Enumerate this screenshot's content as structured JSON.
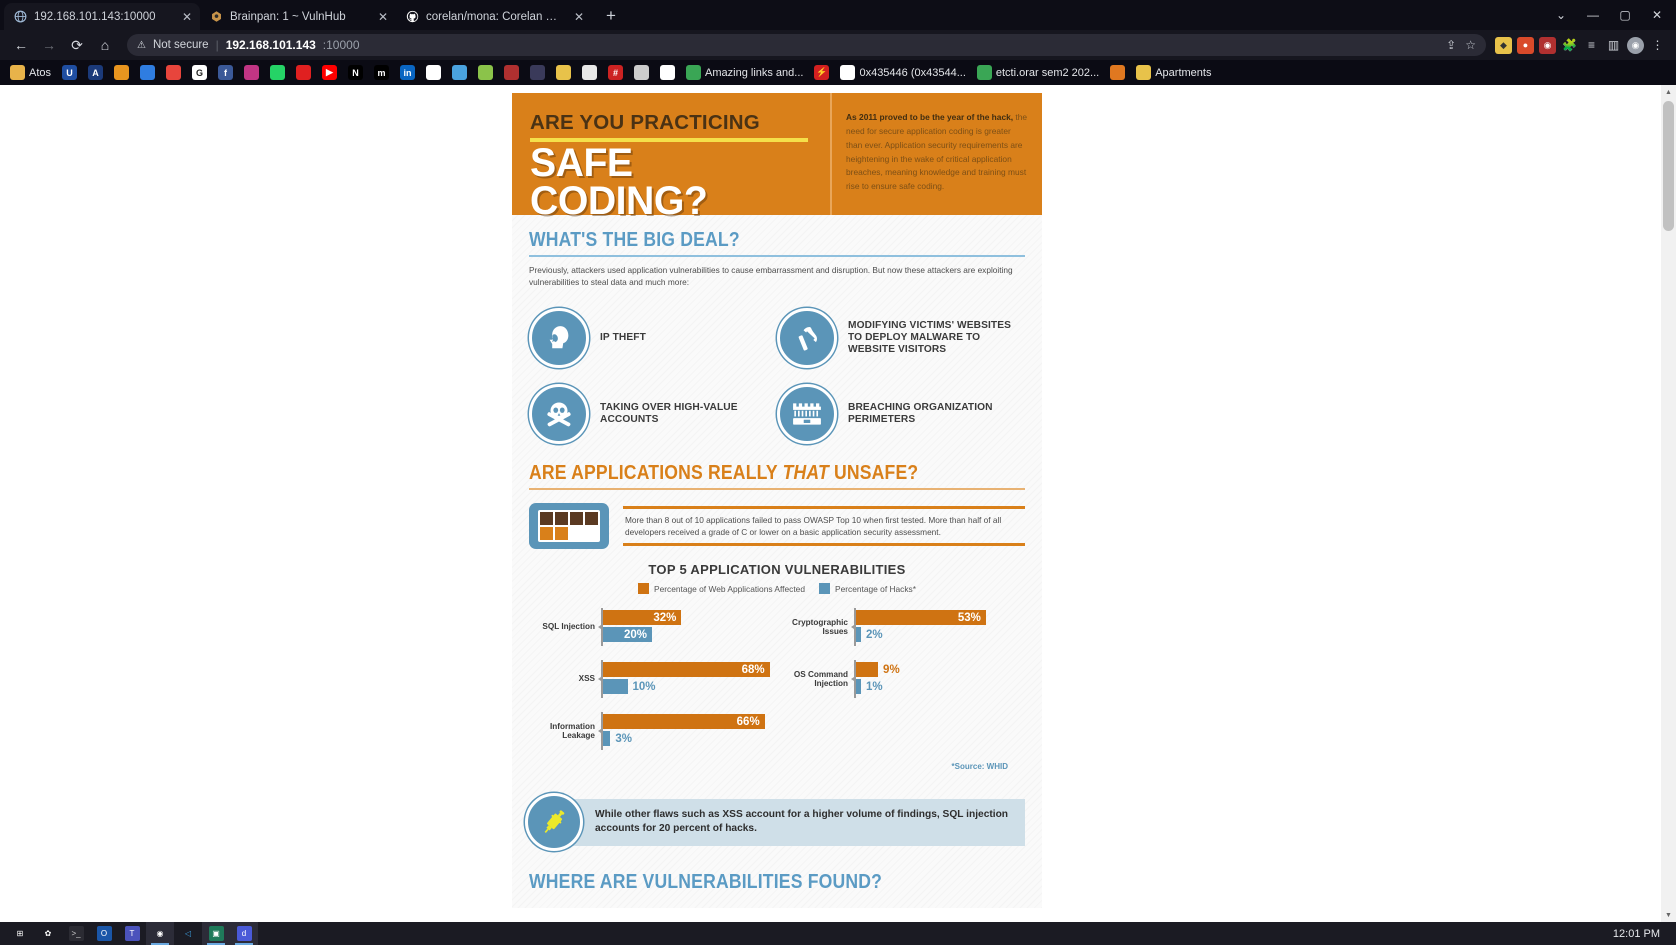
{
  "browser": {
    "tabs": [
      {
        "title": "192.168.101.143:10000",
        "favicon": "globe-icon",
        "active": true
      },
      {
        "title": "Brainpan: 1 ~ VulnHub",
        "favicon": "vulnhub-icon",
        "active": false
      },
      {
        "title": "corelan/mona: Corelan Repositor",
        "favicon": "github-icon",
        "active": false
      }
    ],
    "new_tab_label": "+",
    "window_controls": [
      "⌄",
      "—",
      "▢",
      "✕"
    ],
    "toolbar": {
      "back": "←",
      "forward": "→",
      "reload": "⟳",
      "home": "⌂",
      "security_label": "Not secure",
      "url_host": "192.168.101.143",
      "url_port": ":10000",
      "share_icon": "share-icon",
      "bookmark_icon": "star-icon",
      "menu_icon": "kebab-menu-icon",
      "profile_icon": "profile-avatar-icon",
      "sidepanel_icon": "side-panel-icon",
      "extensions_icon": "puzzle-piece-icon",
      "reading_list_icon": "reading-list-icon"
    },
    "bookmarks": [
      {
        "label": "Atos",
        "color": "#e8b34a",
        "glyph": "",
        "has_label": true
      },
      {
        "label": "",
        "color": "#1f4ea1",
        "glyph": "U",
        "has_label": false
      },
      {
        "label": "",
        "color": "#1b3a7a",
        "glyph": "A",
        "has_label": false
      },
      {
        "label": "",
        "color": "#e8951f",
        "glyph": "",
        "has_label": false
      },
      {
        "label": "",
        "color": "#2f7de1",
        "glyph": "",
        "has_label": false
      },
      {
        "label": "",
        "color": "#e8453c",
        "glyph": "",
        "has_label": false
      },
      {
        "label": "",
        "color": "#ffffff",
        "glyph": "G",
        "has_label": false
      },
      {
        "label": "",
        "color": "#3b5998",
        "glyph": "f",
        "has_label": false
      },
      {
        "label": "",
        "color": "#c13584",
        "glyph": "",
        "has_label": false
      },
      {
        "label": "",
        "color": "#25d366",
        "glyph": "",
        "has_label": false
      },
      {
        "label": "",
        "color": "#e02020",
        "glyph": "",
        "has_label": false
      },
      {
        "label": "",
        "color": "#ff0000",
        "glyph": "▶",
        "has_label": false
      },
      {
        "label": "",
        "color": "#000000",
        "glyph": "N",
        "has_label": false
      },
      {
        "label": "",
        "color": "#000000",
        "glyph": "m",
        "has_label": false
      },
      {
        "label": "",
        "color": "#0a66c2",
        "glyph": "in",
        "has_label": false
      },
      {
        "label": "",
        "color": "#ffffff",
        "glyph": "",
        "has_label": false
      },
      {
        "label": "",
        "color": "#4aa3df",
        "glyph": "",
        "has_label": false
      },
      {
        "label": "",
        "color": "#8bc34a",
        "glyph": "",
        "has_label": false
      },
      {
        "label": "",
        "color": "#b03030",
        "glyph": "",
        "has_label": false
      },
      {
        "label": "",
        "color": "#3a3a5a",
        "glyph": "",
        "has_label": false
      },
      {
        "label": "",
        "color": "#e8c24a",
        "glyph": "",
        "has_label": false
      },
      {
        "label": "",
        "color": "#e8e8e8",
        "glyph": "",
        "has_label": false
      },
      {
        "label": "",
        "color": "#cc2222",
        "glyph": "#",
        "has_label": false
      },
      {
        "label": "",
        "color": "#cccccc",
        "glyph": "",
        "has_label": false
      },
      {
        "label": "",
        "color": "#ffffff",
        "glyph": "",
        "has_label": false
      },
      {
        "label": "Amazing links and...",
        "color": "#3aa655",
        "glyph": "",
        "has_label": true
      },
      {
        "label": "",
        "color": "#d32020",
        "glyph": "⚡",
        "has_label": false
      },
      {
        "label": "0x435446 (0x43544...",
        "color": "#ffffff",
        "glyph": "",
        "has_label": true
      },
      {
        "label": "etcti.orar sem2 202...",
        "color": "#3aa655",
        "glyph": "",
        "has_label": true
      },
      {
        "label": "",
        "color": "#e07820",
        "glyph": "",
        "has_label": false
      },
      {
        "label": "Apartments",
        "color": "#e8c24a",
        "glyph": "",
        "has_label": true
      }
    ]
  },
  "infographic": {
    "header": {
      "line1": "ARE YOU PRACTICING",
      "line2": "SAFE CODING?",
      "intro_bold": "As 2011 proved to be the year of the hack,",
      "intro_rest": " the need for secure application coding is greater than ever. Application security requirements are heightening in the wake of critical application breaches, meaning knowledge and training must rise to ensure safe coding."
    },
    "section1": {
      "heading": "WHAT'S THE BIG DEAL?",
      "paragraph": "Previously, attackers used application vulnerabilities to cause embarrassment and disruption. But now these attackers are exploiting vulnerabilities to steal data and much more:",
      "items": [
        {
          "label": "IP THEFT",
          "icon": "head-hand-icon"
        },
        {
          "label": "MODIFYING VICTIMS' WEBSITES TO DEPLOY MALWARE TO WEBSITE VISITORS",
          "icon": "hammer-icon"
        },
        {
          "label": "TAKING OVER HIGH-VALUE ACCOUNTS",
          "icon": "skull-crossbones-icon"
        },
        {
          "label": "BREACHING ORGANIZATION PERIMETERS",
          "icon": "fortress-wall-icon"
        }
      ]
    },
    "section2": {
      "heading_pre": "ARE APPLICATIONS REALLY ",
      "heading_em": "THAT",
      "heading_post": " UNSAFE?",
      "stat_text": "More than 8 out of 10 applications failed to pass OWASP Top 10 when first tested. More than half of all developers received a grade of C or lower on a basic application security assessment.",
      "source_note": "*Source: WHID",
      "callout": "While other flaws such as XSS account for a higher volume of findings, SQL injection accounts for 20 percent of hacks.",
      "callout_icon": "syringe-icon"
    },
    "section3": {
      "heading": "WHERE ARE VULNERABILITIES FOUND?"
    },
    "colors": {
      "orange": "#d9801a",
      "bar_orange": "#cf7312",
      "blue": "#5b95b8",
      "heading_blue": "#5b9bc4",
      "yellow": "#f5e04a",
      "callout_bg": "#cfdfe8"
    }
  },
  "chart_data": {
    "type": "bar",
    "title": "TOP 5 APPLICATION VULNERABILITIES",
    "orientation": "horizontal",
    "xlabel": "",
    "ylabel": "",
    "xlim": [
      0,
      100
    ],
    "grid": false,
    "legend_position": "top-center",
    "legend": [
      {
        "name": "Percentage of Web Applications Affected",
        "color": "#cf7312"
      },
      {
        "name": "Percentage of Hacks*",
        "color": "#5b95b8"
      }
    ],
    "categories": [
      "SQL Injection",
      "XSS",
      "Information Leakage",
      "Cryptographic Issues",
      "OS Command Injection"
    ],
    "series": [
      {
        "name": "Percentage of Web Applications Affected",
        "color": "#cf7312",
        "values": [
          32,
          68,
          66,
          53,
          9
        ],
        "labels": [
          "32%",
          "68%",
          "66%",
          "53%",
          "9%"
        ]
      },
      {
        "name": "Percentage of Hacks*",
        "color": "#5b95b8",
        "values": [
          20,
          10,
          3,
          2,
          1
        ],
        "labels": [
          "20%",
          "10%",
          "3%",
          "2%",
          "1%"
        ]
      }
    ],
    "left_column": [
      {
        "category": "SQL Injection",
        "orange": 32,
        "orange_label": "32%",
        "blue": 20,
        "blue_label": "20%"
      },
      {
        "category": "XSS",
        "orange": 68,
        "orange_label": "68%",
        "blue": 10,
        "blue_label": "10%"
      },
      {
        "category": "Information Leakage",
        "orange": 66,
        "orange_label": "66%",
        "blue": 3,
        "blue_label": "3%"
      }
    ],
    "right_column": [
      {
        "category": "Cryptographic Issues",
        "orange": 53,
        "orange_label": "53%",
        "blue": 2,
        "blue_label": "2%"
      },
      {
        "category": "OS Command Injection",
        "orange": 9,
        "orange_label": "9%",
        "blue": 1,
        "blue_label": "1%"
      }
    ],
    "source": "*Source: WHID"
  },
  "taskbar": {
    "items": [
      {
        "name": "start-button",
        "glyph": "⊞",
        "color": "#ffffff",
        "bg": "transparent",
        "active": false
      },
      {
        "name": "settings-icon",
        "glyph": "✿",
        "color": "#ffffff",
        "bg": "transparent",
        "active": false
      },
      {
        "name": "terminal-icon",
        "glyph": ">_",
        "color": "#cccccc",
        "bg": "#2b2b33",
        "active": false
      },
      {
        "name": "outlook-icon",
        "glyph": "O",
        "color": "#ffffff",
        "bg": "#1a56a8",
        "active": false
      },
      {
        "name": "teams-icon",
        "glyph": "T",
        "color": "#ffffff",
        "bg": "#4b53bc",
        "active": false
      },
      {
        "name": "chrome-icon",
        "glyph": "◉",
        "color": "#ffffff",
        "bg": "transparent",
        "active": true
      },
      {
        "name": "vscode-icon",
        "glyph": "◁",
        "color": "#3da0e3",
        "bg": "transparent",
        "active": false
      },
      {
        "name": "file-explorer-icon",
        "glyph": "▣",
        "color": "#ffffff",
        "bg": "#1f7a5a",
        "active": true
      },
      {
        "name": "app-icon",
        "glyph": "d",
        "color": "#ffffff",
        "bg": "#4a5ad8",
        "active": true
      }
    ],
    "clock": "12:01 PM"
  }
}
